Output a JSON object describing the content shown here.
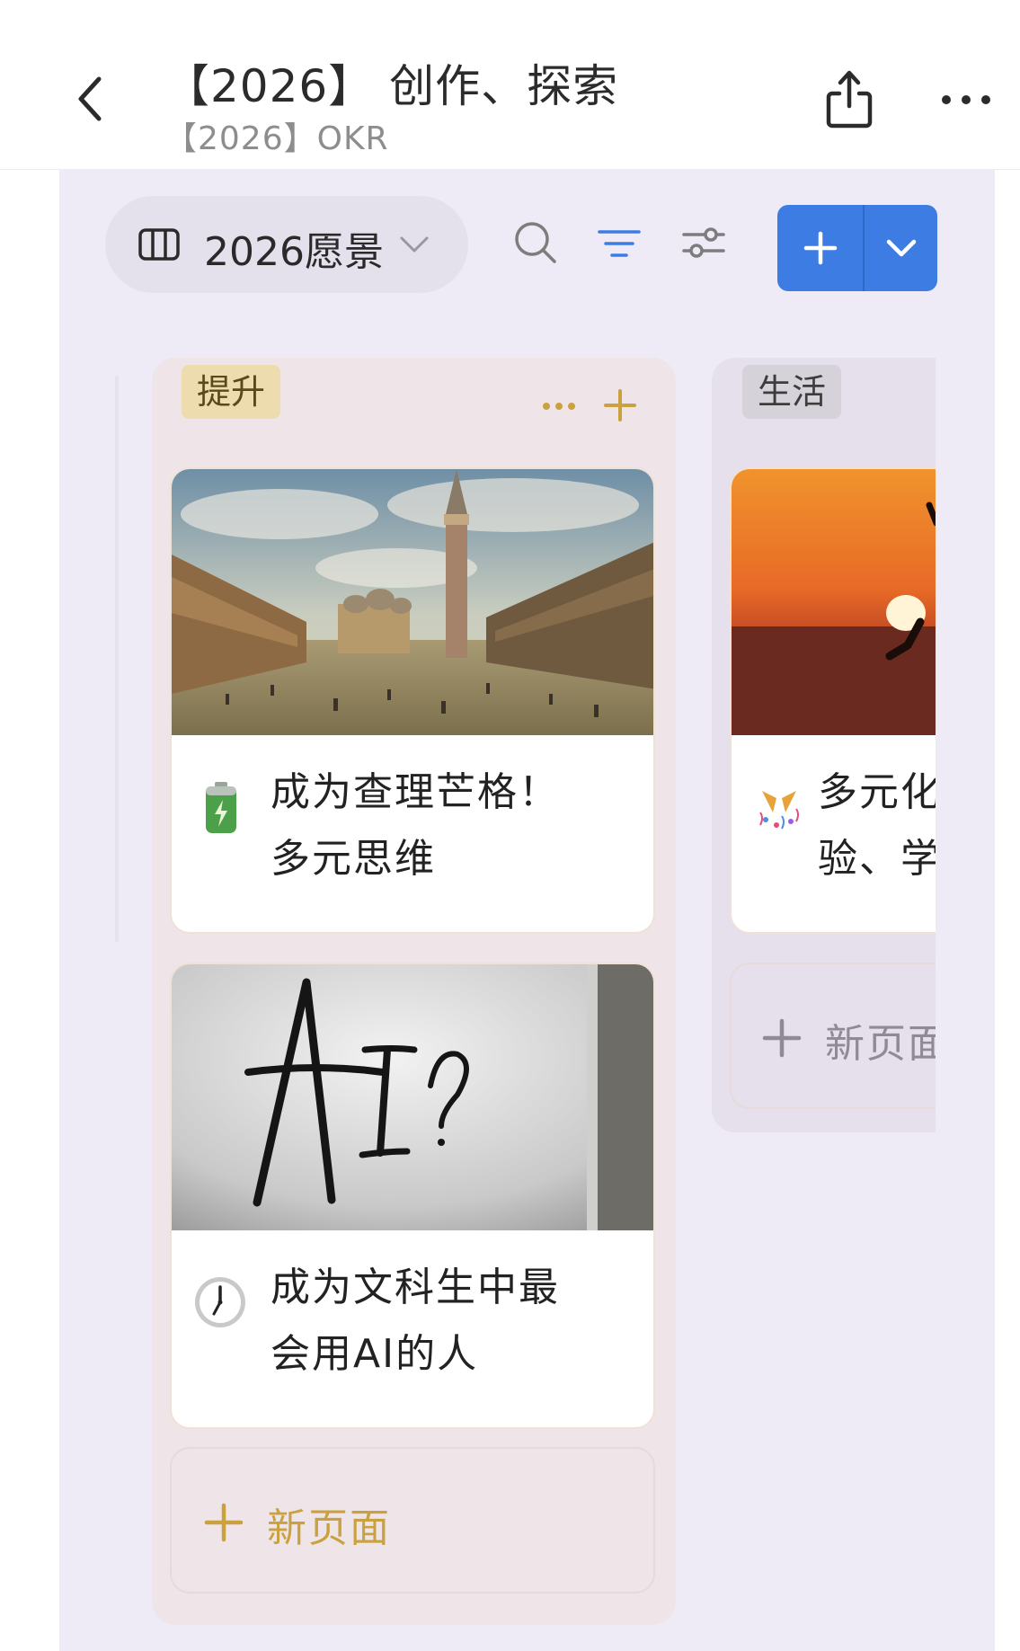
{
  "header": {
    "title": "【2026】 创作、探索",
    "subtitle": "【2026】OKR",
    "back_icon": "chevron-left-icon",
    "share_icon": "share-icon",
    "more_icon": "more-horizontal-icon"
  },
  "toolbar": {
    "view_label": "2026愿景",
    "view_icon": "board-view-icon",
    "search_icon": "search-icon",
    "filter_icon": "filter-icon",
    "settings_icon": "sliders-icon",
    "add_icon": "plus-icon",
    "add_menu_icon": "chevron-down-icon",
    "accent_color": "#3d7de3"
  },
  "columns": [
    {
      "tag": "提升",
      "tag_color": "#ecdcae",
      "cards": [
        {
          "icon": "battery-emoji",
          "title_line1": "成为查理芒格！",
          "title_line2": "多元思维",
          "cover": "venice-square-painting"
        },
        {
          "icon": "clock-emoji",
          "title_line1": "成为文科生中最",
          "title_line2": "会用AI的人",
          "cover": "ai-handwriting-photo"
        }
      ],
      "new_page": "新页面"
    },
    {
      "tag": "生活",
      "tag_color": "#d6d2da",
      "cards": [
        {
          "icon": "party-popper-emoji",
          "title_line1": "多元化",
          "title_line2": "验、学",
          "cover": "sunset-jump-photo"
        }
      ],
      "new_page": "新页面"
    }
  ]
}
